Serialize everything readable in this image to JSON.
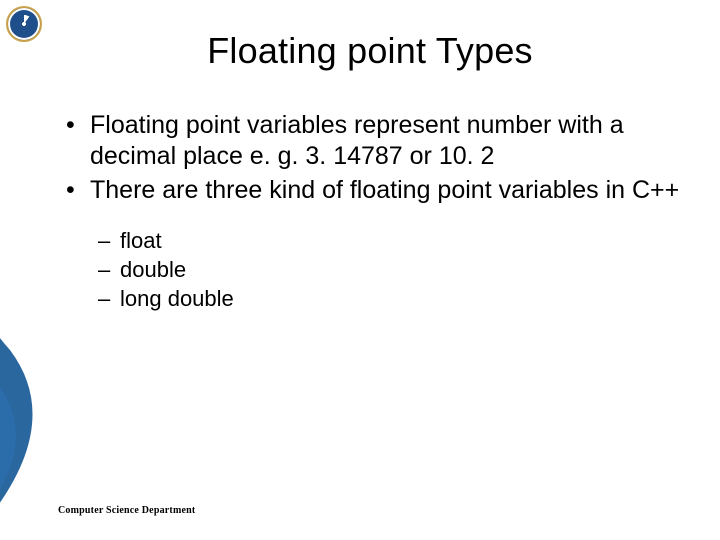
{
  "title": "Floating point Types",
  "bullets": [
    "Floating point variables represent number with a decimal place e. g. 3. 14787 or 10. 2",
    "There are three kind of floating point variables in C++"
  ],
  "sub_bullets": [
    "float",
    "double",
    "long double"
  ],
  "footer": "Computer Science Department"
}
